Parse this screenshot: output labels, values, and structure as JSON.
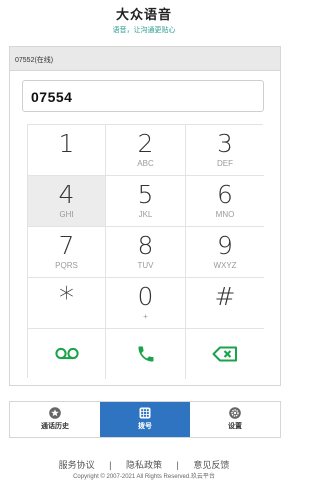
{
  "header": {
    "title": "大众语音",
    "subtitle": "语音，让沟通更贴心"
  },
  "status": {
    "line": "07552(在线)"
  },
  "dialer": {
    "number": "07554"
  },
  "keypad": {
    "keys": [
      {
        "digit": "1",
        "letters": ""
      },
      {
        "digit": "2",
        "letters": "ABC"
      },
      {
        "digit": "3",
        "letters": "DEF"
      },
      {
        "digit": "4",
        "letters": "GHI"
      },
      {
        "digit": "5",
        "letters": "JKL"
      },
      {
        "digit": "6",
        "letters": "MNO"
      },
      {
        "digit": "7",
        "letters": "PQRS"
      },
      {
        "digit": "8",
        "letters": "TUV"
      },
      {
        "digit": "9",
        "letters": "WXYZ"
      },
      {
        "digit": "*",
        "letters": ""
      },
      {
        "digit": "0",
        "letters": "+"
      },
      {
        "digit": "#",
        "letters": ""
      }
    ],
    "actions": [
      {
        "icon": "voicemail-icon"
      },
      {
        "icon": "phone-call-icon"
      },
      {
        "icon": "backspace-icon"
      }
    ]
  },
  "tabs": [
    {
      "label": "通话历史",
      "icon": "star-icon",
      "active": false
    },
    {
      "label": "拨号",
      "icon": "dialpad-icon",
      "active": true
    },
    {
      "label": "设置",
      "icon": "gear-icon",
      "active": false
    }
  ],
  "footer": {
    "links": [
      "服务协议",
      "隐私政策",
      "意见反馈"
    ],
    "separator": "|",
    "copyright": "Copyright © 2007-2021 All Rights Reserved.玖云平台"
  },
  "colors": {
    "accent": "#2f74c0",
    "call_green": "#1aa34a",
    "subtitle_teal": "#2a9d8f"
  }
}
